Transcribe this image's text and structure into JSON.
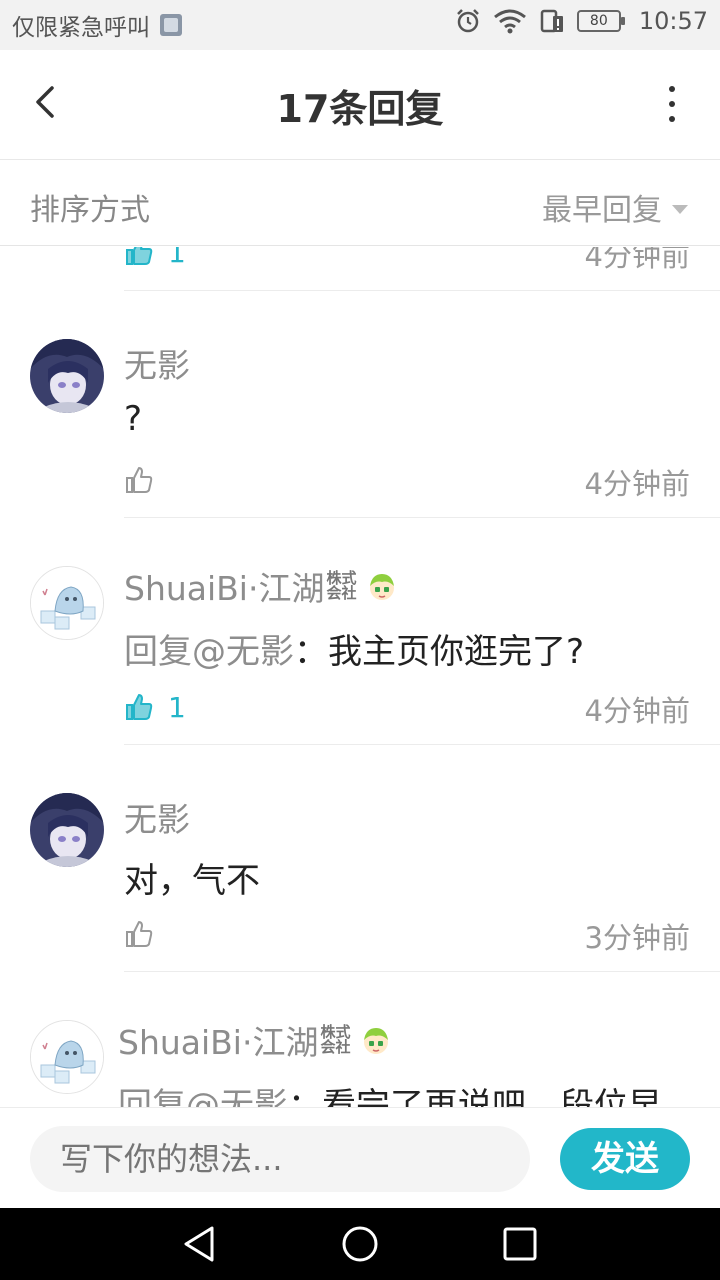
{
  "status_bar": {
    "carrier_text": "仅限紧急呼叫",
    "battery": "80",
    "time": "10:57"
  },
  "header": {
    "title": "17条回复"
  },
  "sort": {
    "label": "排序方式",
    "selected": "最早回复"
  },
  "comments": [
    {
      "username": "",
      "content": "",
      "likes": "1",
      "time": "4分钟前",
      "partial": "top"
    },
    {
      "username": "无影",
      "content": "?",
      "likes": "",
      "time": "4分钟前"
    },
    {
      "username": "ShuaiBi·江湖",
      "company_tag_line1": "株式",
      "company_tag_line2": "会社",
      "mention": "回复@无影",
      "content": "：我主页你逛完了?",
      "likes": "1",
      "time": "4分钟前"
    },
    {
      "username": "无影",
      "content": "对，气不",
      "likes": "",
      "time": "3分钟前"
    },
    {
      "username": "ShuaiBi·江湖",
      "company_tag_line1": "株式",
      "company_tag_line2": "会社",
      "mention": "回复@无影",
      "content": "：看完了再说吧，段位早",
      "likes": "",
      "time": "",
      "partial": "bottom"
    }
  ],
  "composer": {
    "placeholder": "写下你的想法...",
    "send_label": "发送"
  },
  "colors": {
    "accent": "#22b7c9",
    "muted_text": "#8d8d8d"
  }
}
